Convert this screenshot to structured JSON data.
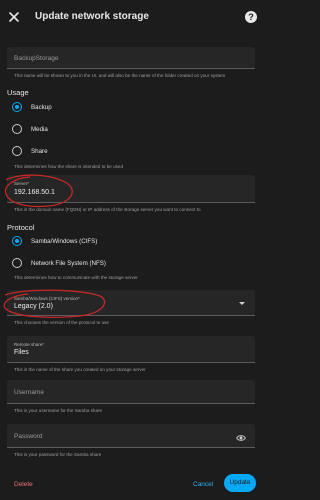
{
  "header": {
    "title": "Update network storage",
    "close_icon": "close-icon",
    "help_icon": "help-circle-icon",
    "help_glyph": "?"
  },
  "name_field": {
    "placeholder": "BackupStorage",
    "helper": "This name will be shown to you in the UI, and will also be the name of the folder created on your system"
  },
  "usage": {
    "heading": "Usage",
    "options": [
      {
        "label": "Backup",
        "checked": true
      },
      {
        "label": "Media",
        "checked": false
      },
      {
        "label": "Share",
        "checked": false
      }
    ],
    "helper": "This determines how the share is intended to be used"
  },
  "server_field": {
    "label": "Server*",
    "value": "192.168.50.1",
    "helper": "This is the domain name (FQDN) or IP address of the storage server you want to connect to"
  },
  "protocol": {
    "heading": "Protocol",
    "options": [
      {
        "label": "Samba/Windows (CIFS)",
        "checked": true
      },
      {
        "label": "Network File System (NFS)",
        "checked": false
      }
    ],
    "helper": "This determines how to communicate with the storage server"
  },
  "version_field": {
    "label": "Samba/Windows (CIFS) version*",
    "value": "Legacy (2.0)",
    "helper": "This chooses the version of the protocol to use"
  },
  "share_field": {
    "label": "Remote share*",
    "value": "Files",
    "helper": "This is the name of the share you created on your storage server"
  },
  "username_field": {
    "placeholder": "Username",
    "helper": "This is your username for the Samba share"
  },
  "password_field": {
    "placeholder": "Password",
    "helper": "This is your password for the Samba share"
  },
  "footer": {
    "delete_label": "Delete",
    "cancel_label": "Cancel",
    "update_label": "Update"
  },
  "colors": {
    "background": "#1c1c1c",
    "accent": "#03a9f4",
    "delete": "#e57373",
    "annotation": "#c62828"
  }
}
